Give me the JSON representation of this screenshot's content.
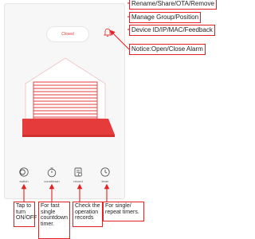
{
  "status": "Closed",
  "controls": [
    {
      "icon": "toggle-icon",
      "label": "switch"
    },
    {
      "icon": "timer-icon",
      "label": "countdown"
    },
    {
      "icon": "record-icon",
      "label": "record"
    },
    {
      "icon": "clock-icon",
      "label": "timer"
    }
  ],
  "callouts": {
    "rename": "Rename/Share/OTA/Remove",
    "manage": "Manage Group/Position",
    "device": "Device ID/IP/MAC/Feedback",
    "notice": "Notice:Open/Close Alarm"
  },
  "notes": {
    "switch": "Tap to turn ON/OFF",
    "countdown": "For fast single countdown timer.",
    "record": "Check the operation records",
    "timer": "For single/ repeat timers."
  },
  "colors": {
    "accent": "#e63b3b",
    "callout_border": "#e62020"
  }
}
